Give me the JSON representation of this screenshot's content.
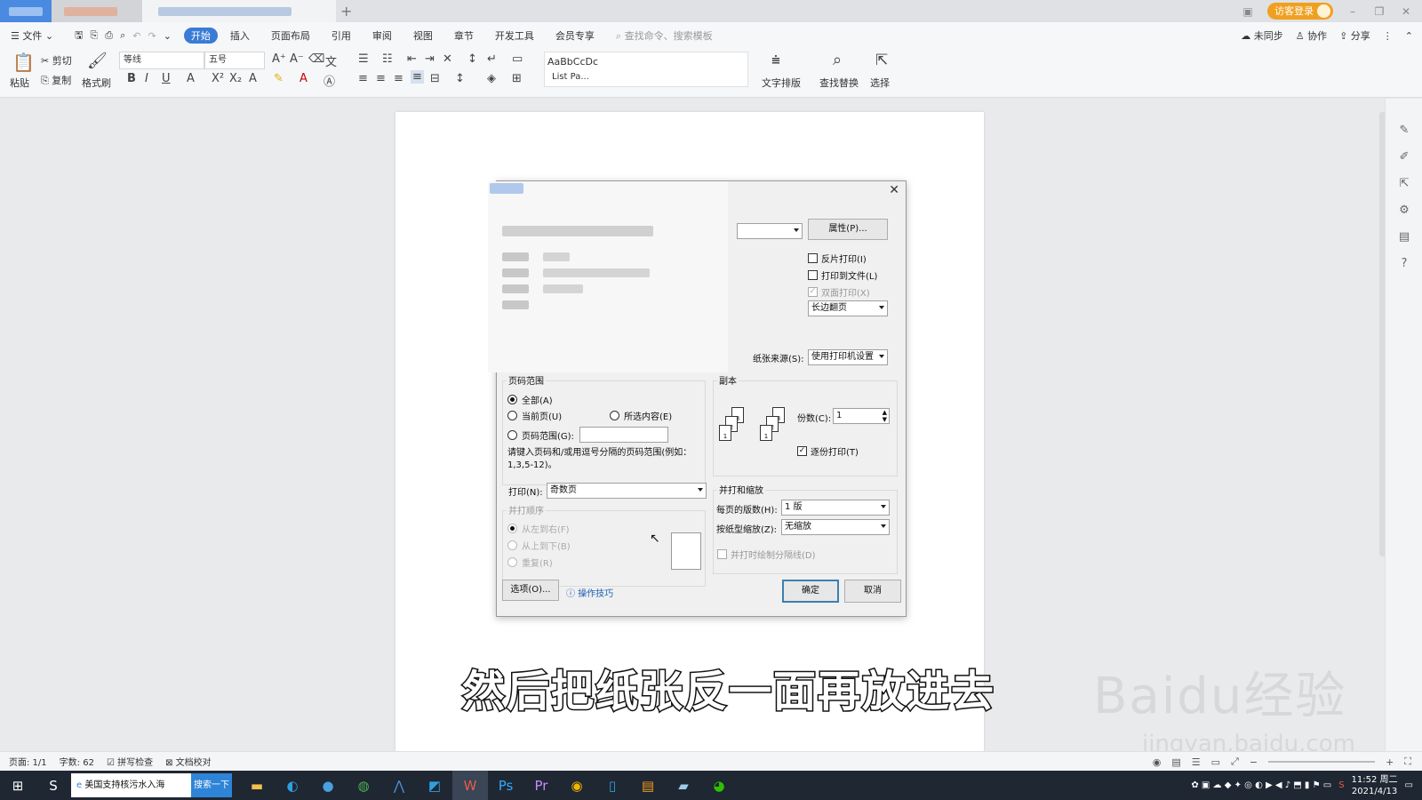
{
  "menu": {
    "file": "文件",
    "tabs": [
      "开始",
      "插入",
      "页面布局",
      "引用",
      "审阅",
      "视图",
      "章节",
      "开发工具",
      "会员专享"
    ],
    "active_tab": "开始",
    "search_placeholder": "查找命令、搜索模板",
    "right": [
      "未同步",
      "协作",
      "分享"
    ]
  },
  "titlebar": {
    "login": "访客登录"
  },
  "ribbon": {
    "paste": "粘贴",
    "cut": "剪切",
    "copy": "复制",
    "format_painter": "格式刷",
    "font_name": "等线",
    "font_size": "五号",
    "style_preview": "AaBbCcDc",
    "style_name": "List Pa...",
    "text_layout": "文字排版",
    "find_replace": "查找替换",
    "select": "选择"
  },
  "dialog": {
    "properties_btn": "属性(P)...",
    "reverse_print": "反片打印(I)",
    "print_to_file": "打印到文件(L)",
    "duplex": "双面打印(X)",
    "flip_mode": "长边翻页",
    "paper_source_label": "纸张来源(S):",
    "paper_source_value": "使用打印机设置",
    "page_range_group": "页码范围",
    "all": "全部(A)",
    "current_page": "当前页(U)",
    "selection": "所选内容(E)",
    "page_range": "页码范围(G):",
    "range_hint": "请键入页码和/或用逗号分隔的页码范围(例如：1,3,5-12)。",
    "print_label": "打印(N):",
    "print_value": "奇数页",
    "collate_group": "并打顺序",
    "left_to_right": "从左到右(F)",
    "top_to_bottom": "从上到下(B)",
    "repeat": "重复(R)",
    "copies_group": "副本",
    "copies_label": "份数(C):",
    "copies_value": "1",
    "collate_print": "逐份打印(T)",
    "scale_group": "并打和缩放",
    "pages_per_sheet_label": "每页的版数(H):",
    "pages_per_sheet_value": "1 版",
    "scale_to_paper_label": "按纸型缩放(Z):",
    "scale_to_paper_value": "无缩放",
    "draw_borders": "并打时绘制分隔线(D)",
    "options_btn": "选项(O)...",
    "tips_link": "操作技巧",
    "ok_btn": "确定",
    "cancel_btn": "取消"
  },
  "subtitle": "然后把纸张反一面再放进去",
  "watermark": {
    "logo": "Baidu经验",
    "url": "jingyan.baidu.com"
  },
  "statusbar": {
    "page": "页面: 1/1",
    "words": "字数: 62",
    "spellcheck": "拼写检查",
    "proofread": "文档校对"
  },
  "taskbar": {
    "search_text": "美国支持核污水入海",
    "search_btn": "搜索一下",
    "time": "11:52 周二",
    "date": "2021/4/13"
  },
  "colors": {
    "accent": "#3a7bd5",
    "login": "#f0a020",
    "taskbar": "#1f2733"
  }
}
